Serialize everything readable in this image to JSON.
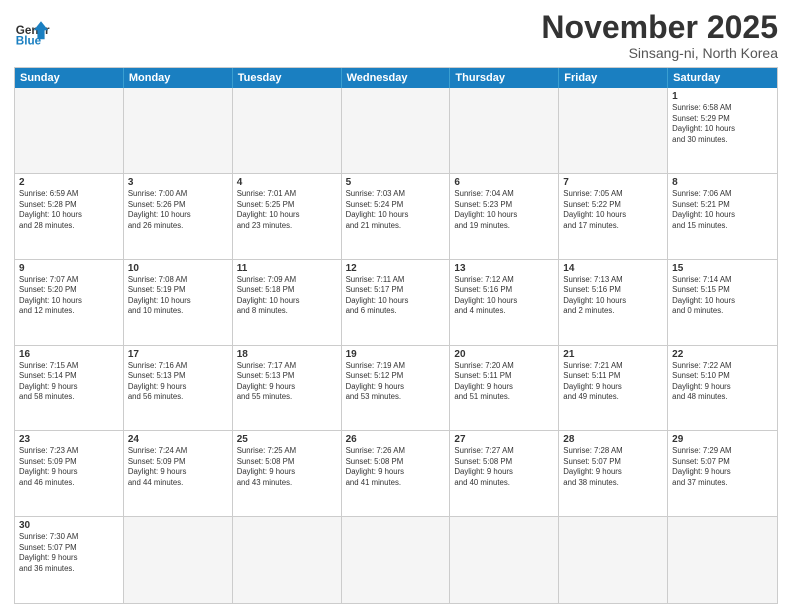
{
  "logo": {
    "line1": "General",
    "line2": "Blue"
  },
  "title": "November 2025",
  "subtitle": "Sinsang-ni, North Korea",
  "header_days": [
    "Sunday",
    "Monday",
    "Tuesday",
    "Wednesday",
    "Thursday",
    "Friday",
    "Saturday"
  ],
  "weeks": [
    [
      {
        "day": "",
        "info": "",
        "empty": true
      },
      {
        "day": "",
        "info": "",
        "empty": true
      },
      {
        "day": "",
        "info": "",
        "empty": true
      },
      {
        "day": "",
        "info": "",
        "empty": true
      },
      {
        "day": "",
        "info": "",
        "empty": true
      },
      {
        "day": "",
        "info": "",
        "empty": true
      },
      {
        "day": "1",
        "info": "Sunrise: 6:58 AM\nSunset: 5:29 PM\nDaylight: 10 hours\nand 30 minutes.",
        "empty": false
      }
    ],
    [
      {
        "day": "2",
        "info": "Sunrise: 6:59 AM\nSunset: 5:28 PM\nDaylight: 10 hours\nand 28 minutes.",
        "empty": false
      },
      {
        "day": "3",
        "info": "Sunrise: 7:00 AM\nSunset: 5:26 PM\nDaylight: 10 hours\nand 26 minutes.",
        "empty": false
      },
      {
        "day": "4",
        "info": "Sunrise: 7:01 AM\nSunset: 5:25 PM\nDaylight: 10 hours\nand 23 minutes.",
        "empty": false
      },
      {
        "day": "5",
        "info": "Sunrise: 7:03 AM\nSunset: 5:24 PM\nDaylight: 10 hours\nand 21 minutes.",
        "empty": false
      },
      {
        "day": "6",
        "info": "Sunrise: 7:04 AM\nSunset: 5:23 PM\nDaylight: 10 hours\nand 19 minutes.",
        "empty": false
      },
      {
        "day": "7",
        "info": "Sunrise: 7:05 AM\nSunset: 5:22 PM\nDaylight: 10 hours\nand 17 minutes.",
        "empty": false
      },
      {
        "day": "8",
        "info": "Sunrise: 7:06 AM\nSunset: 5:21 PM\nDaylight: 10 hours\nand 15 minutes.",
        "empty": false
      }
    ],
    [
      {
        "day": "9",
        "info": "Sunrise: 7:07 AM\nSunset: 5:20 PM\nDaylight: 10 hours\nand 12 minutes.",
        "empty": false
      },
      {
        "day": "10",
        "info": "Sunrise: 7:08 AM\nSunset: 5:19 PM\nDaylight: 10 hours\nand 10 minutes.",
        "empty": false
      },
      {
        "day": "11",
        "info": "Sunrise: 7:09 AM\nSunset: 5:18 PM\nDaylight: 10 hours\nand 8 minutes.",
        "empty": false
      },
      {
        "day": "12",
        "info": "Sunrise: 7:11 AM\nSunset: 5:17 PM\nDaylight: 10 hours\nand 6 minutes.",
        "empty": false
      },
      {
        "day": "13",
        "info": "Sunrise: 7:12 AM\nSunset: 5:16 PM\nDaylight: 10 hours\nand 4 minutes.",
        "empty": false
      },
      {
        "day": "14",
        "info": "Sunrise: 7:13 AM\nSunset: 5:16 PM\nDaylight: 10 hours\nand 2 minutes.",
        "empty": false
      },
      {
        "day": "15",
        "info": "Sunrise: 7:14 AM\nSunset: 5:15 PM\nDaylight: 10 hours\nand 0 minutes.",
        "empty": false
      }
    ],
    [
      {
        "day": "16",
        "info": "Sunrise: 7:15 AM\nSunset: 5:14 PM\nDaylight: 9 hours\nand 58 minutes.",
        "empty": false
      },
      {
        "day": "17",
        "info": "Sunrise: 7:16 AM\nSunset: 5:13 PM\nDaylight: 9 hours\nand 56 minutes.",
        "empty": false
      },
      {
        "day": "18",
        "info": "Sunrise: 7:17 AM\nSunset: 5:13 PM\nDaylight: 9 hours\nand 55 minutes.",
        "empty": false
      },
      {
        "day": "19",
        "info": "Sunrise: 7:19 AM\nSunset: 5:12 PM\nDaylight: 9 hours\nand 53 minutes.",
        "empty": false
      },
      {
        "day": "20",
        "info": "Sunrise: 7:20 AM\nSunset: 5:11 PM\nDaylight: 9 hours\nand 51 minutes.",
        "empty": false
      },
      {
        "day": "21",
        "info": "Sunrise: 7:21 AM\nSunset: 5:11 PM\nDaylight: 9 hours\nand 49 minutes.",
        "empty": false
      },
      {
        "day": "22",
        "info": "Sunrise: 7:22 AM\nSunset: 5:10 PM\nDaylight: 9 hours\nand 48 minutes.",
        "empty": false
      }
    ],
    [
      {
        "day": "23",
        "info": "Sunrise: 7:23 AM\nSunset: 5:09 PM\nDaylight: 9 hours\nand 46 minutes.",
        "empty": false
      },
      {
        "day": "24",
        "info": "Sunrise: 7:24 AM\nSunset: 5:09 PM\nDaylight: 9 hours\nand 44 minutes.",
        "empty": false
      },
      {
        "day": "25",
        "info": "Sunrise: 7:25 AM\nSunset: 5:08 PM\nDaylight: 9 hours\nand 43 minutes.",
        "empty": false
      },
      {
        "day": "26",
        "info": "Sunrise: 7:26 AM\nSunset: 5:08 PM\nDaylight: 9 hours\nand 41 minutes.",
        "empty": false
      },
      {
        "day": "27",
        "info": "Sunrise: 7:27 AM\nSunset: 5:08 PM\nDaylight: 9 hours\nand 40 minutes.",
        "empty": false
      },
      {
        "day": "28",
        "info": "Sunrise: 7:28 AM\nSunset: 5:07 PM\nDaylight: 9 hours\nand 38 minutes.",
        "empty": false
      },
      {
        "day": "29",
        "info": "Sunrise: 7:29 AM\nSunset: 5:07 PM\nDaylight: 9 hours\nand 37 minutes.",
        "empty": false
      }
    ],
    [
      {
        "day": "30",
        "info": "Sunrise: 7:30 AM\nSunset: 5:07 PM\nDaylight: 9 hours\nand 36 minutes.",
        "empty": false
      },
      {
        "day": "",
        "info": "",
        "empty": true
      },
      {
        "day": "",
        "info": "",
        "empty": true
      },
      {
        "day": "",
        "info": "",
        "empty": true
      },
      {
        "day": "",
        "info": "",
        "empty": true
      },
      {
        "day": "",
        "info": "",
        "empty": true
      },
      {
        "day": "",
        "info": "",
        "empty": true
      }
    ]
  ]
}
